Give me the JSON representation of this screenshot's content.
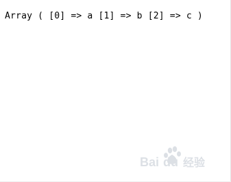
{
  "output": {
    "text": "Array ( [0] => a [1] => b [2] => c )"
  },
  "watermark": {
    "text": "Baidu经验",
    "icon": "baidu-paw-logo",
    "color": "#d9dde3"
  }
}
